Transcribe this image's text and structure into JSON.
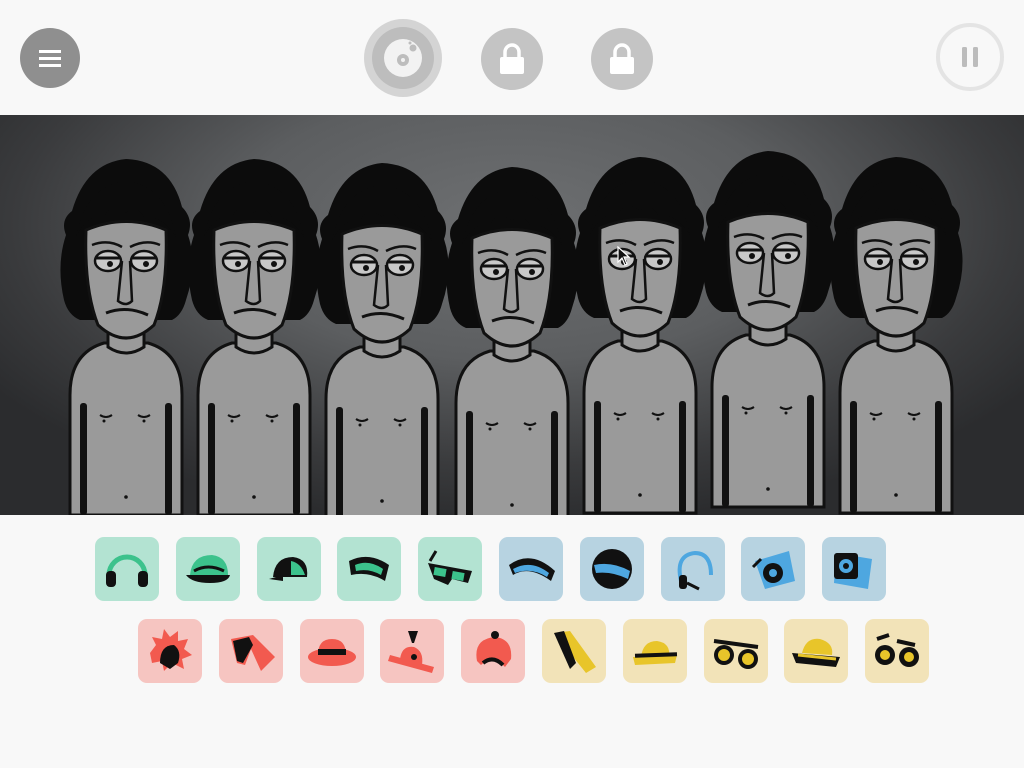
{
  "toolbar": {
    "menu_icon": "hamburger-icon",
    "record_icon": "vinyl-disc-icon",
    "locked_bonus_icon": "padlock-icon",
    "pause_icon": "pause-icon"
  },
  "stage": {
    "character_count": 7,
    "character_state": "idle-uncostumed"
  },
  "colors": {
    "beats": "#b3e3d2",
    "effects": "#b7d3e1",
    "melodies": "#f6c5c1",
    "voices": "#f2e3b8",
    "icon_dark": "#111111",
    "green_accent": "#3cc28c",
    "blue_accent": "#4ea7e0",
    "red_accent": "#f25a4f",
    "yellow_accent": "#e8c52a"
  },
  "row1": [
    {
      "icon": "headphones-icon",
      "group": "beat"
    },
    {
      "icon": "cap-icon",
      "group": "beat"
    },
    {
      "icon": "backward-cap-icon",
      "group": "beat"
    },
    {
      "icon": "ski-goggles-icon",
      "group": "beat"
    },
    {
      "icon": "3d-glasses-icon",
      "group": "beat"
    },
    {
      "icon": "visor-glasses-icon",
      "group": "effect"
    },
    {
      "icon": "mask-icon",
      "group": "effect"
    },
    {
      "icon": "earpiece-icon",
      "group": "effect"
    },
    {
      "icon": "ear-icon",
      "group": "effect"
    },
    {
      "icon": "speaker-box-icon",
      "group": "effect"
    }
  ],
  "row2": [
    {
      "icon": "spiky-hair-icon",
      "group": "melody"
    },
    {
      "icon": "bandana-icon",
      "group": "melody"
    },
    {
      "icon": "boater-hat-icon",
      "group": "melody"
    },
    {
      "icon": "tilted-hat-icon",
      "group": "melody"
    },
    {
      "icon": "beanie-icon",
      "group": "melody"
    },
    {
      "icon": "scarf-icon",
      "group": "voice"
    },
    {
      "icon": "fedora-icon",
      "group": "voice"
    },
    {
      "icon": "sunglasses-icon",
      "group": "voice"
    },
    {
      "icon": "wide-hat-icon",
      "group": "voice"
    },
    {
      "icon": "round-glasses-icon",
      "group": "voice"
    }
  ]
}
